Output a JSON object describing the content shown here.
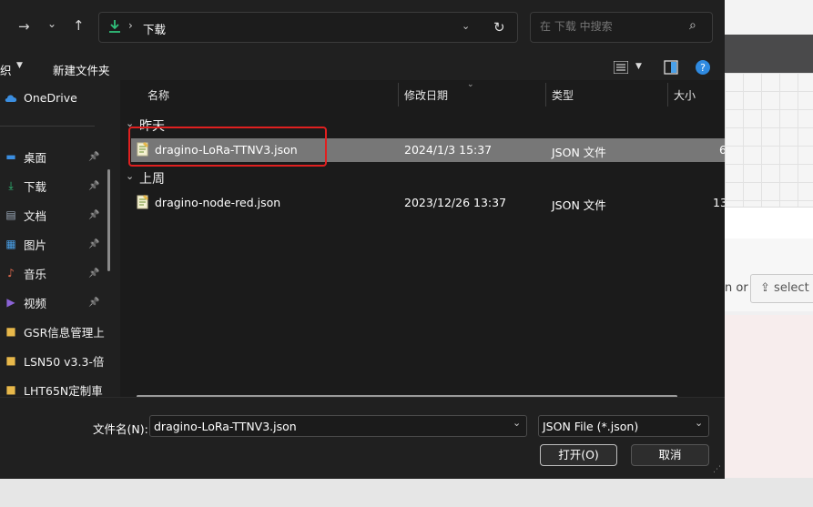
{
  "nav": {
    "back_icon": "back-arrow",
    "forward_icon": "forward-arrow",
    "recent_icon": "chevron-down",
    "up_icon": "up-arrow"
  },
  "address": {
    "separator": "›",
    "current_folder": "下载"
  },
  "search": {
    "placeholder": "在 下载 中搜索"
  },
  "toolbar": {
    "organize_label": "织",
    "new_folder_label": "新建文件夹"
  },
  "sidebar": {
    "onedrive": "OneDrive",
    "items": [
      {
        "label": "桌面",
        "icon": "desktop-icon",
        "color": "#3b8ee0",
        "pinned": true
      },
      {
        "label": "下载",
        "icon": "download-icon",
        "color": "#30c07a",
        "pinned": true
      },
      {
        "label": "文档",
        "icon": "document-icon",
        "color": "#9aa8b8",
        "pinned": true
      },
      {
        "label": "图片",
        "icon": "picture-icon",
        "color": "#4aa0e8",
        "pinned": true
      },
      {
        "label": "音乐",
        "icon": "music-icon",
        "color": "#e26a4e",
        "pinned": true
      },
      {
        "label": "视频",
        "icon": "video-icon",
        "color": "#8b63d6",
        "pinned": true
      },
      {
        "label": "GSR信息管理上",
        "icon": "folder-icon",
        "color": "#e8b84a",
        "pinned": false
      },
      {
        "label": "LSN50 v3.3-倍",
        "icon": "folder-icon",
        "color": "#e8b84a",
        "pinned": false
      },
      {
        "label": "LHT65N定制車",
        "icon": "folder-icon",
        "color": "#e8b84a",
        "pinned": false
      }
    ]
  },
  "columns": {
    "name": "名称",
    "date": "修改日期",
    "type": "类型",
    "size": "大小"
  },
  "groups": [
    {
      "label": "昨天",
      "files": [
        {
          "name": "dragino-LoRa-TTNV3.json",
          "date": "2024/1/3 15:37",
          "type": "JSON 文件",
          "size": "6"
        }
      ]
    },
    {
      "label": "上周",
      "files": [
        {
          "name": "dragino-node-red.json",
          "date": "2023/12/26 13:37",
          "type": "JSON 文件",
          "size": "13"
        }
      ]
    }
  ],
  "bottom": {
    "filename_label": "文件名(N):",
    "filename_value": "dragino-LoRa-TTNV3.json",
    "filetype_value": "JSON File (*.json)",
    "open_label": "打开(O)",
    "cancel_label": "取消"
  },
  "background": {
    "or_text": "n or",
    "select_text": "select a"
  },
  "colors": {
    "highlight": "#e02020",
    "selected_row": "#777777",
    "accent": "#0078d4"
  }
}
